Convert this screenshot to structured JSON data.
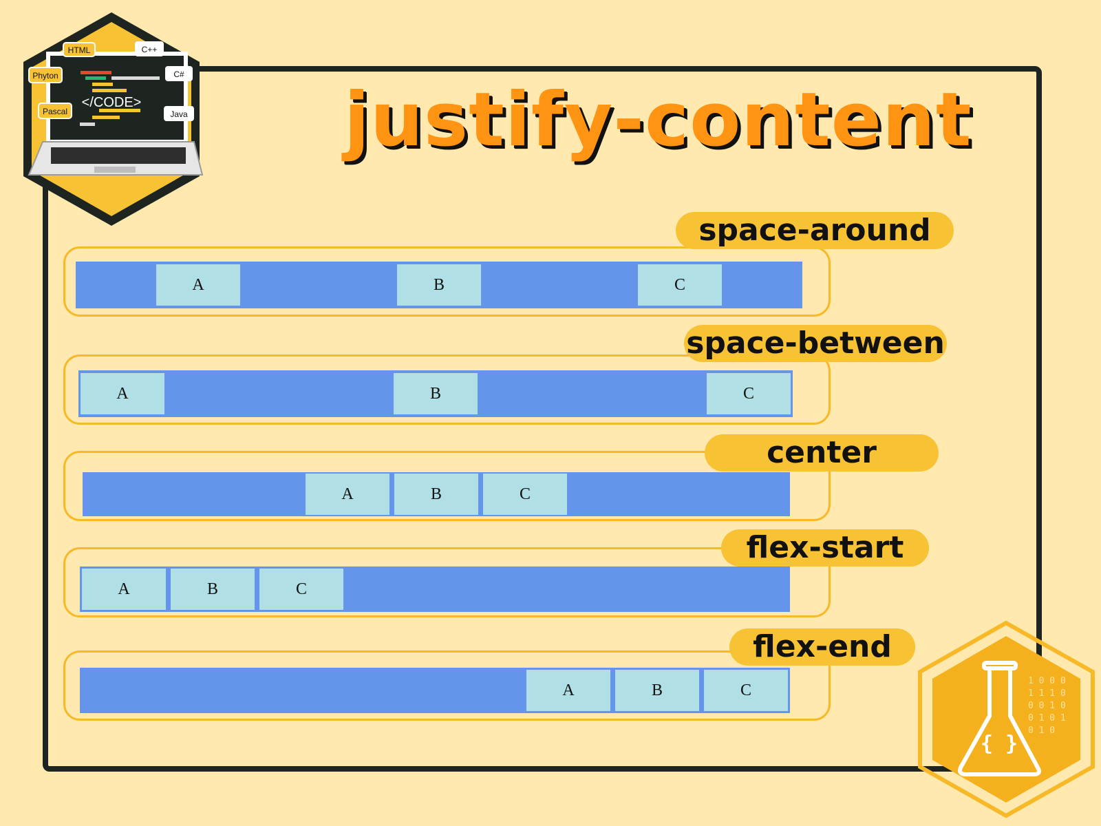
{
  "title": "justify-content",
  "badge": {
    "tags": [
      "HTML",
      "C++",
      "Phyton",
      "C#",
      "Pascal",
      "Java"
    ],
    "screen_text": "</CODE>"
  },
  "lab_badge": {
    "binary_rows": [
      "1 0 0 0",
      "1 1 1 0",
      "0 0 1 0",
      "0 1 0 1",
      "0 1 0"
    ],
    "flask_text": "{ }"
  },
  "rows": [
    {
      "label": "space-around",
      "items": [
        "A",
        "B",
        "C"
      ]
    },
    {
      "label": "space-between",
      "items": [
        "A",
        "B",
        "C"
      ]
    },
    {
      "label": "center",
      "items": [
        "A",
        "B",
        "C"
      ]
    },
    {
      "label": "flex-start",
      "items": [
        "A",
        "B",
        "C"
      ]
    },
    {
      "label": "flex-end",
      "items": [
        "A",
        "B",
        "C"
      ]
    }
  ],
  "colors": {
    "background": "#FFE9AE",
    "frame": "#1E2420",
    "title": "#FF9312",
    "label_pill": "#F7C233",
    "track": "#6495EB",
    "item": "#B0E0E6",
    "outline": "#F7B928"
  }
}
